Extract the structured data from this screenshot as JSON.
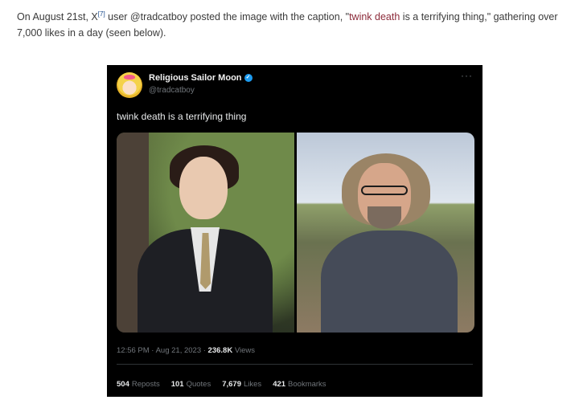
{
  "article": {
    "part1": "On August 21st, X",
    "footnote": "[7]",
    "part2": " user @tradcatboy posted the image with the caption, \"",
    "link": "twink death",
    "part3": " is a terrifying thing,\" gathering over 7,000 likes in a day (seen below)."
  },
  "tweet": {
    "display_name": "Religious Sailor Moon",
    "verified_icon": "✓",
    "handle": "@tradcatboy",
    "more": "···",
    "text": "twink death is a terrifying thing",
    "time": "12:56 PM · Aug 21, 2023 · ",
    "views_count": "236.8K",
    "views_label": " Views",
    "stats": [
      {
        "count": "504",
        "label": "Reposts"
      },
      {
        "count": "101",
        "label": "Quotes"
      },
      {
        "count": "7,679",
        "label": "Likes"
      },
      {
        "count": "421",
        "label": "Bookmarks"
      }
    ]
  },
  "colors": {
    "tweet_bg": "#000000",
    "verified": "#1d9bf0",
    "link": "#8c2b3a"
  }
}
